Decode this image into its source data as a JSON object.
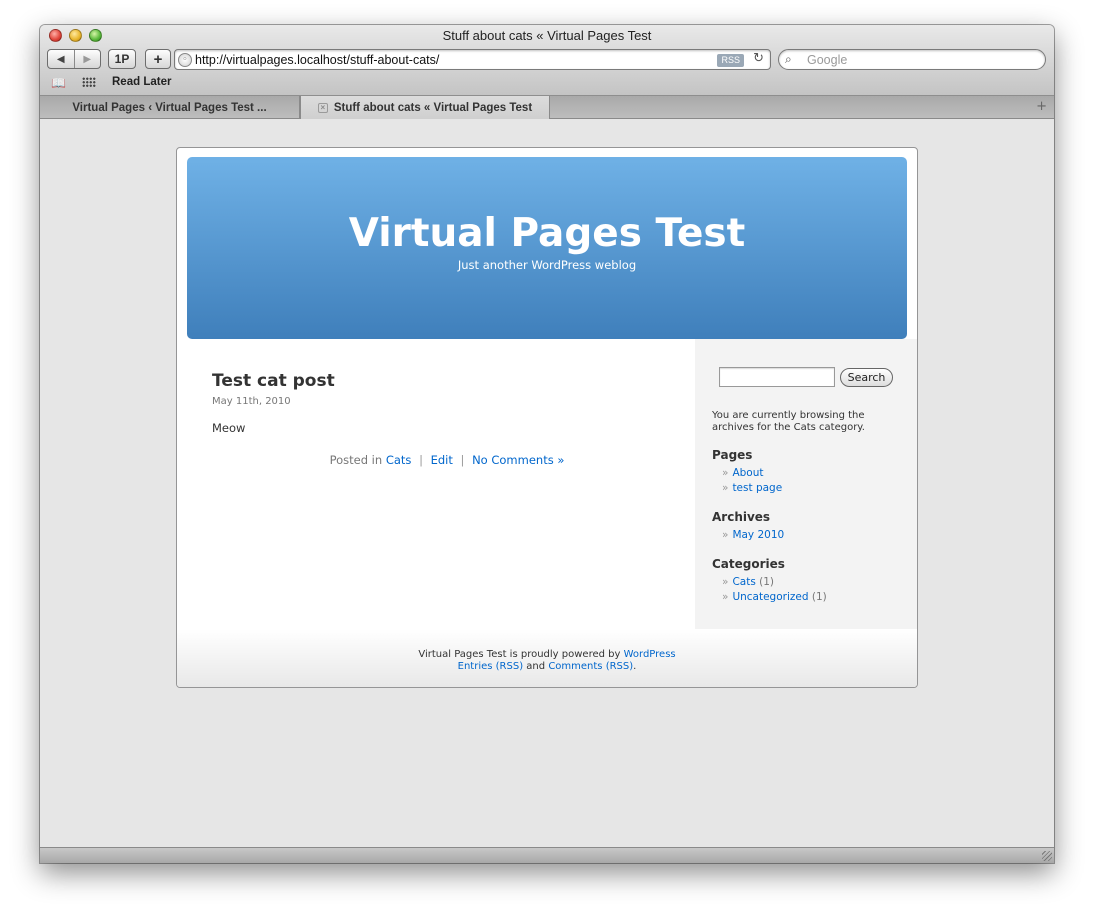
{
  "window": {
    "title": "Stuff about cats « Virtual Pages Test"
  },
  "toolbar": {
    "back_icon": "◀",
    "forward_icon": "▶",
    "onepassword_label": "1P",
    "add_label": "+",
    "url": "http://virtualpages.localhost/stuff-about-cats/",
    "rss_label": "RSS",
    "reload_icon": "↻",
    "search_placeholder": "Google",
    "search_icon": "⌕"
  },
  "bookmarks": {
    "read_later_label": "Read Later"
  },
  "tabs": [
    {
      "label": "Virtual Pages ‹ Virtual Pages Test ..."
    },
    {
      "label": "Stuff about cats « Virtual Pages Test",
      "close_icon": "×"
    }
  ],
  "tab_add_icon": "+",
  "blog": {
    "title": "Virtual Pages Test",
    "description": "Just another WordPress weblog"
  },
  "post": {
    "title": "Test cat post",
    "date": "May 11th, 2010",
    "body": "Meow",
    "meta_prefix": "Posted in",
    "category": "Cats",
    "sep": "|",
    "edit": "Edit",
    "comments": "No Comments »"
  },
  "sidebar": {
    "search_button": "Search",
    "browsing": "You are currently browsing the archives for the Cats category.",
    "pages_heading": "Pages",
    "pages": [
      {
        "label": "About"
      },
      {
        "label": "test page"
      }
    ],
    "archives_heading": "Archives",
    "archives": [
      {
        "label": "May 2010"
      }
    ],
    "categories_heading": "Categories",
    "categories": [
      {
        "label": "Cats",
        "count": "(1)"
      },
      {
        "label": "Uncategorized",
        "count": "(1)"
      }
    ],
    "bullet": "»"
  },
  "footer": {
    "powered_prefix": "Virtual Pages Test is proudly powered by",
    "wordpress": "WordPress",
    "entries": "Entries (RSS)",
    "and": "and",
    "comments": "Comments (RSS)",
    "period": "."
  },
  "colors": {
    "link": "#0066cc",
    "header_top": "#6fb1e6",
    "header_bottom": "#3f7fbb"
  }
}
